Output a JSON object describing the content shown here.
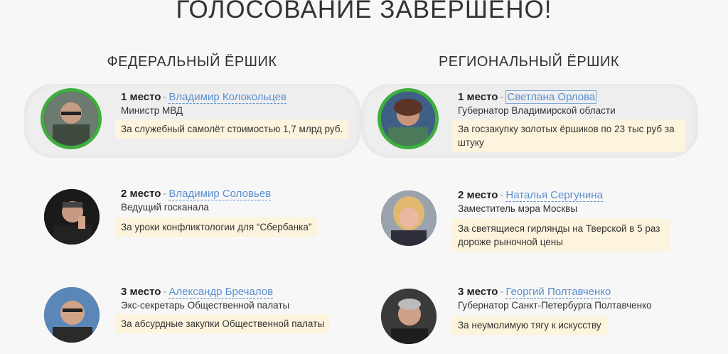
{
  "page": {
    "title": "ГОЛОСОВАНИЕ ЗАВЕРШЕНО!"
  },
  "federal": {
    "heading": "ФЕДЕРАЛЬНЫЙ ЁРШИК",
    "entries": [
      {
        "place": "1 место",
        "name": "Владимир Колокольцев",
        "role": "Министр МВД",
        "reason": "За служебный самолёт стоимостью 1,7 млрд руб."
      },
      {
        "place": "2 место",
        "name": "Владимир Соловьев",
        "role": "Ведущий госканала",
        "reason": "За уроки конфликтологии для “Сбербанка”"
      },
      {
        "place": "3 место",
        "name": "Александр Бречалов",
        "role": "Экс-секретарь Общественной палаты",
        "reason": "За абсурдные закупки Общественной палаты"
      }
    ]
  },
  "regional": {
    "heading": "РЕГИОНАЛЬНЫЙ ЁРШИК",
    "entries": [
      {
        "place": "1 место",
        "name": "Светлана Орлова",
        "role": "Губернатор Владимирской области",
        "reason": "За госзакупку золотых ёршиков по 23 тыс руб за штуку"
      },
      {
        "place": "2 место",
        "name": "Наталья Сергунина",
        "role": "Заместитель мэра Москвы",
        "reason": "За светящиеся гирлянды на Тверской в 5 раз дороже рыночной цены"
      },
      {
        "place": "3 место",
        "name": "Георгий Полтавченко",
        "role": "Губернатор Санкт-Петербурга Полтавченко",
        "reason": "За неумолимую тягу к искусству"
      }
    ]
  },
  "colors": {
    "winner_ring": "#3fae3f",
    "link": "#5a8fd0",
    "reason_bg": "#fcf4dc"
  },
  "separator": "-"
}
